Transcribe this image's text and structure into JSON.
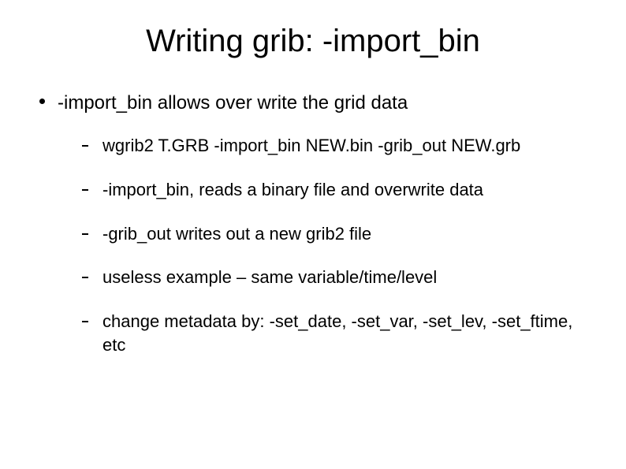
{
  "title": "Writing grib: -import_bin",
  "bullets": {
    "top": "-import_bin allows over write the grid data",
    "sub": [
      "wgrib2 T.GRB -import_bin NEW.bin -grib_out NEW.grb",
      "-import_bin, reads a binary file and overwrite data",
      "-grib_out writes out a new grib2 file",
      "useless example – same variable/time/level",
      "change metadata by: -set_date, -set_var, -set_lev, -set_ftime, etc"
    ]
  }
}
